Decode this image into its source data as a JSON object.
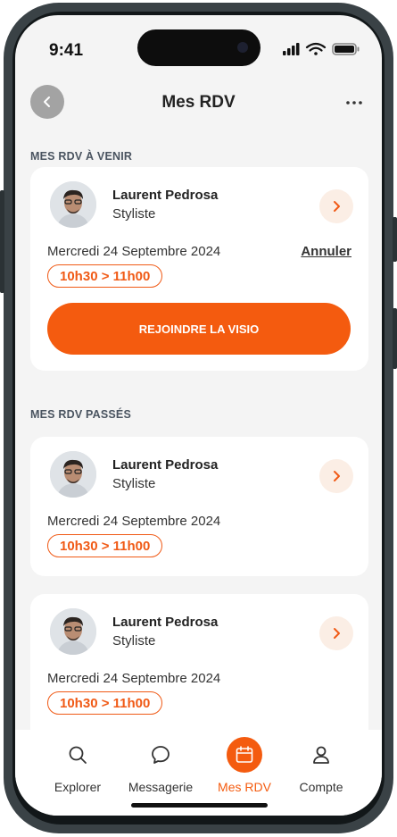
{
  "status_bar": {
    "time": "9:41"
  },
  "header": {
    "title": "Mes RDV",
    "back_icon": "chevron-left-icon",
    "more_icon": "more-icon"
  },
  "sections": {
    "upcoming_title": "MES RDV À VENIR",
    "past_title": "MES RDV PASSÉS"
  },
  "upcoming": {
    "name": "Laurent Pedrosa",
    "role": "Styliste",
    "date": "Mercredi 24 Septembre 2024",
    "time": "10h30 > 11h00",
    "cancel_label": "Annuler",
    "join_label": "REJOINDRE LA VISIO"
  },
  "past": [
    {
      "name": "Laurent Pedrosa",
      "role": "Styliste",
      "date": "Mercredi 24 Septembre 2024",
      "time": "10h30 > 11h00"
    },
    {
      "name": "Laurent Pedrosa",
      "role": "Styliste",
      "date": "Mercredi 24 Septembre 2024",
      "time": "10h30 > 11h00"
    }
  ],
  "tabs": [
    {
      "label": "Explorer",
      "icon": "search-icon",
      "active": false
    },
    {
      "label": "Messagerie",
      "icon": "chat-icon",
      "active": false
    },
    {
      "label": "Mes RDV",
      "icon": "calendar-icon",
      "active": true
    },
    {
      "label": "Compte",
      "icon": "user-icon",
      "active": false
    }
  ],
  "colors": {
    "accent": "#f45b0f",
    "accent_light": "#fbeee5",
    "background": "#f4f4f4"
  }
}
